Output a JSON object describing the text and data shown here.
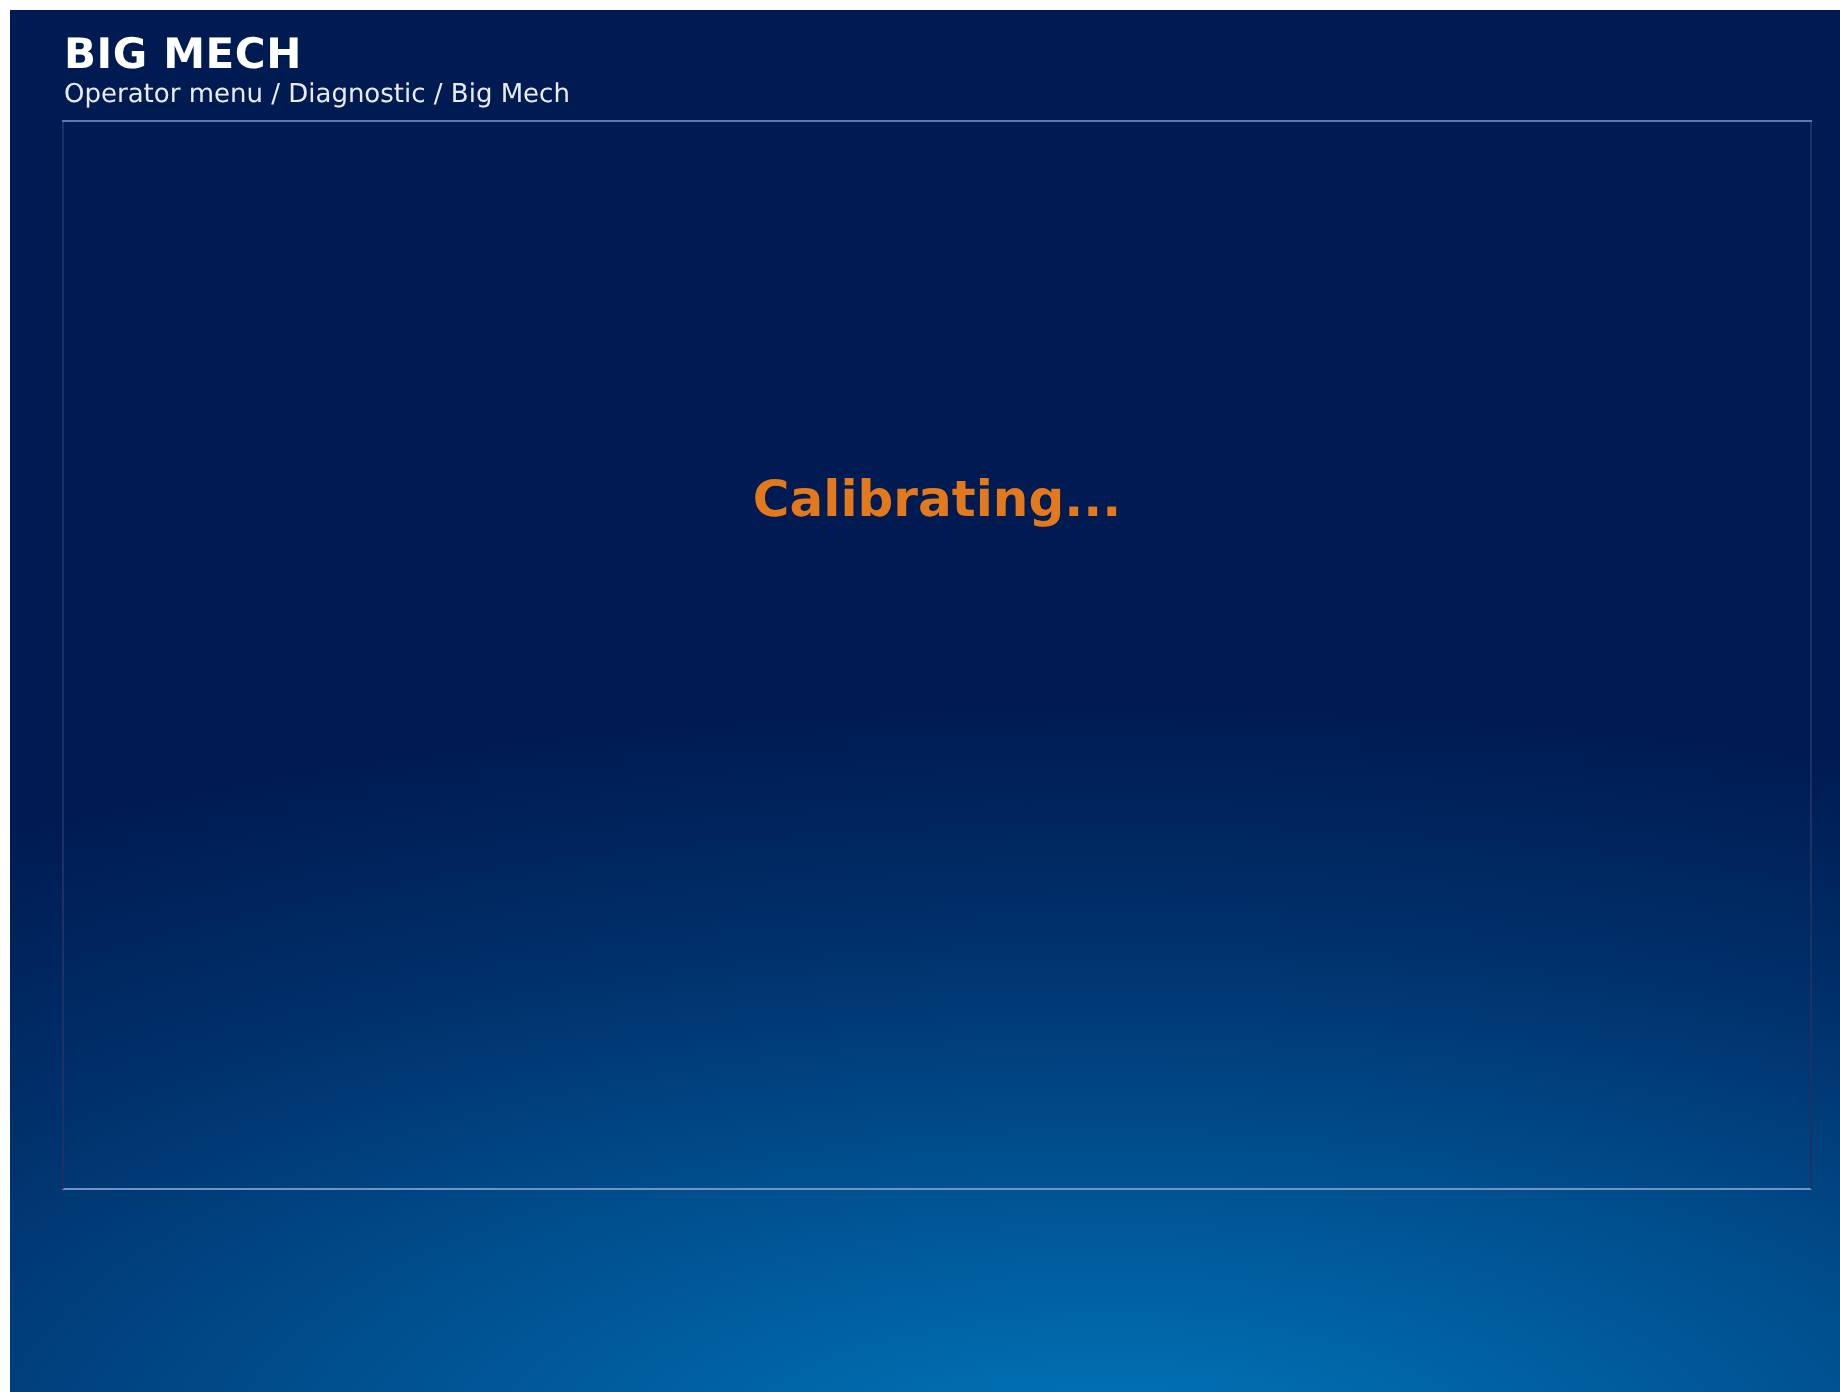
{
  "header": {
    "title": "BIG MECH",
    "breadcrumb": "Operator menu / Diagnostic / Big Mech"
  },
  "panel": {
    "message": "Calibrating..."
  }
}
